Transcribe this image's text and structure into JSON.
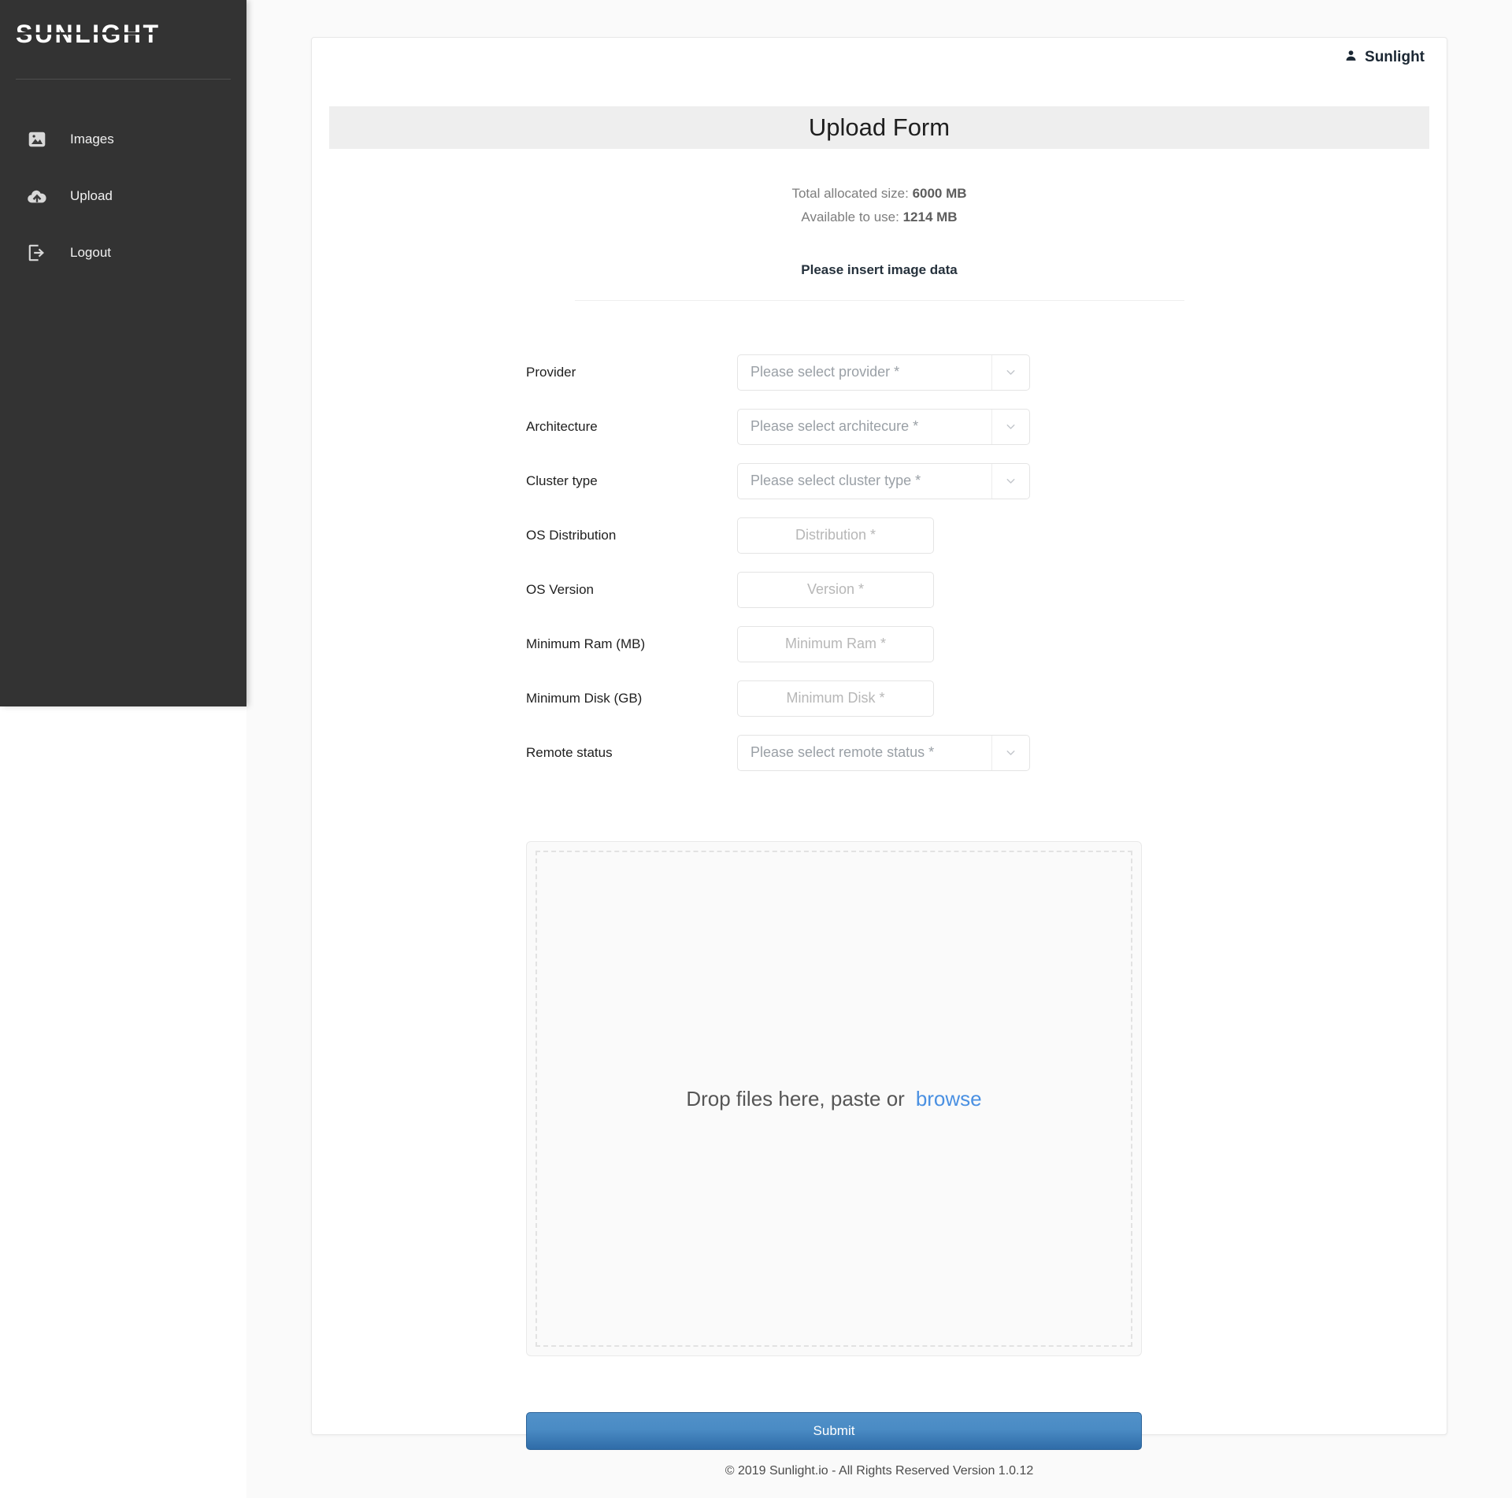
{
  "brand": {
    "logo_text": "SUNLIGHT"
  },
  "sidebar": {
    "items": [
      {
        "label": "Images",
        "icon": "image-icon"
      },
      {
        "label": "Upload",
        "icon": "cloud-upload-icon"
      },
      {
        "label": "Logout",
        "icon": "logout-icon"
      }
    ]
  },
  "header": {
    "user_name": "Sunlight",
    "user_icon": "person-icon"
  },
  "main": {
    "title": "Upload Form",
    "total_allocated_label": "Total allocated size:",
    "total_allocated_value": "6000 MB",
    "available_label": "Available to use:",
    "available_value": "1214 MB",
    "section_heading": "Please insert image data"
  },
  "form": {
    "fields": [
      {
        "label": "Provider",
        "type": "select",
        "placeholder": "Please select provider *",
        "value": ""
      },
      {
        "label": "Architecture",
        "type": "select",
        "placeholder": "Please select architecure *",
        "value": ""
      },
      {
        "label": "Cluster type",
        "type": "select",
        "placeholder": "Please select cluster type *",
        "value": ""
      },
      {
        "label": "OS Distribution",
        "type": "text",
        "placeholder": "Distribution *",
        "value": ""
      },
      {
        "label": "OS Version",
        "type": "text",
        "placeholder": "Version *",
        "value": ""
      },
      {
        "label": "Minimum Ram (MB)",
        "type": "text",
        "placeholder": "Minimum Ram *",
        "value": ""
      },
      {
        "label": "Minimum Disk (GB)",
        "type": "text",
        "placeholder": "Minimum Disk *",
        "value": ""
      },
      {
        "label": "Remote status",
        "type": "select",
        "placeholder": "Please select remote status *",
        "value": ""
      }
    ]
  },
  "dropzone": {
    "text": "Drop files here, paste or",
    "browse_label": "browse"
  },
  "submit": {
    "label": "Submit"
  },
  "footer": {
    "text": "© 2019 Sunlight.io - All Rights Reserved Version 1.0.12"
  },
  "colors": {
    "sidebar_bg": "#333333",
    "accent_link": "#4a90e2",
    "submit_top": "#5191c9",
    "submit_bottom": "#2f6ca8",
    "banner_bg": "#eeeeee"
  }
}
